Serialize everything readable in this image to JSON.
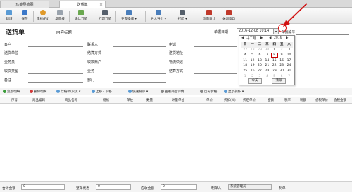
{
  "tabs": [
    {
      "label": "功能导航图"
    },
    {
      "label": "送货单"
    }
  ],
  "toolbar": {
    "items": [
      {
        "label": "新增",
        "icon": "new-icon",
        "color": "#5a9bd5"
      },
      {
        "label": "保存",
        "icon": "save-icon",
        "color": "#3c78c8"
      },
      {
        "label": "审核(F4)",
        "icon": "approve-icon",
        "color": "#e09a2a"
      },
      {
        "label": "反审核",
        "icon": "unapprove-icon",
        "color": "#9aa3ad"
      },
      {
        "label": "确认订单",
        "icon": "confirm-icon",
        "color": "#6aa84f"
      },
      {
        "label": "打印订单",
        "icon": "print-order-icon",
        "color": "#555f6b"
      },
      {
        "label": "更多操作 ▾",
        "icon": "more-icon",
        "color": "#4a7ebb"
      },
      {
        "label": "导入导出 ▾",
        "icon": "import-export-icon",
        "color": "#4a7ebb"
      },
      {
        "label": "打印 ▾",
        "icon": "print-icon",
        "color": "#555f6b"
      },
      {
        "label": "页面设计",
        "icon": "design-icon",
        "color": "#c0392b"
      },
      {
        "label": "关闭窗口",
        "icon": "close-window-icon",
        "color": "#c0392b"
      }
    ]
  },
  "header": {
    "title": "送货单",
    "subtitle": "内容标题",
    "date_label": "单据日期",
    "date_value": "2016-12-08 10:14",
    "docno_label": "单据编号"
  },
  "form": {
    "row1": [
      "客户",
      "联系人",
      "电话"
    ],
    "row2": [
      "送货单位",
      "结算方式",
      "送货地址"
    ],
    "row3": [
      "业务员",
      "收款账户",
      "物流快递"
    ],
    "row4": [
      "收货类型",
      "业务",
      "结算方式"
    ],
    "row5": [
      "备注",
      "部门"
    ]
  },
  "calendar": {
    "month": "十二月",
    "year": "2016",
    "weekdays": [
      "日",
      "一",
      "二",
      "三",
      "四",
      "五",
      "六"
    ],
    "weeks": [
      [
        "27",
        "28",
        "29",
        "30",
        "1",
        "2",
        "3"
      ],
      [
        "4",
        "5",
        "6",
        "7",
        "8",
        "9",
        "10"
      ],
      [
        "11",
        "12",
        "13",
        "14",
        "15",
        "16",
        "17"
      ],
      [
        "18",
        "19",
        "20",
        "21",
        "22",
        "23",
        "24"
      ],
      [
        "25",
        "26",
        "27",
        "28",
        "29",
        "30",
        "31"
      ],
      [
        "1",
        "2",
        "3",
        "4",
        "5",
        "6",
        "7"
      ]
    ],
    "today_btn": "今天",
    "clear_btn": "清除",
    "arrow_color": "#d11111"
  },
  "actions": [
    {
      "label": "追加明细",
      "color": "#3a9c3a"
    },
    {
      "label": "删除明细",
      "color": "#d23a3a"
    },
    {
      "label": "行编辑/只读 ▾",
      "color": "#5a9bd5"
    },
    {
      "label": "上移 · 下移",
      "color": "#5a9bd5"
    },
    {
      "label": "快速排序 ▾",
      "color": "#5a9bd5"
    },
    {
      "label": "查看商品详情",
      "color": "#888888"
    },
    {
      "label": "历史价格",
      "color": "#888888"
    },
    {
      "label": "显示操作 ▾",
      "color": "#5a9bd5"
    }
  ],
  "table": {
    "columns": [
      "序号",
      "商品编码",
      "商品名称",
      "规格",
      "单位",
      "数量",
      "计量单位",
      "单价",
      "折扣(%)",
      "折后单价",
      "金额",
      "税率",
      "税额",
      "含税单价",
      "含税金额"
    ]
  },
  "footer": {
    "total_label": "合计金额",
    "total_value": "0",
    "discount_label": "整单优惠",
    "discount_value": "0",
    "payable_label": "应收金额",
    "payable_value": "0",
    "maker_label": "制单人",
    "maker_value": "系统管理员",
    "extra_label": "制单"
  }
}
